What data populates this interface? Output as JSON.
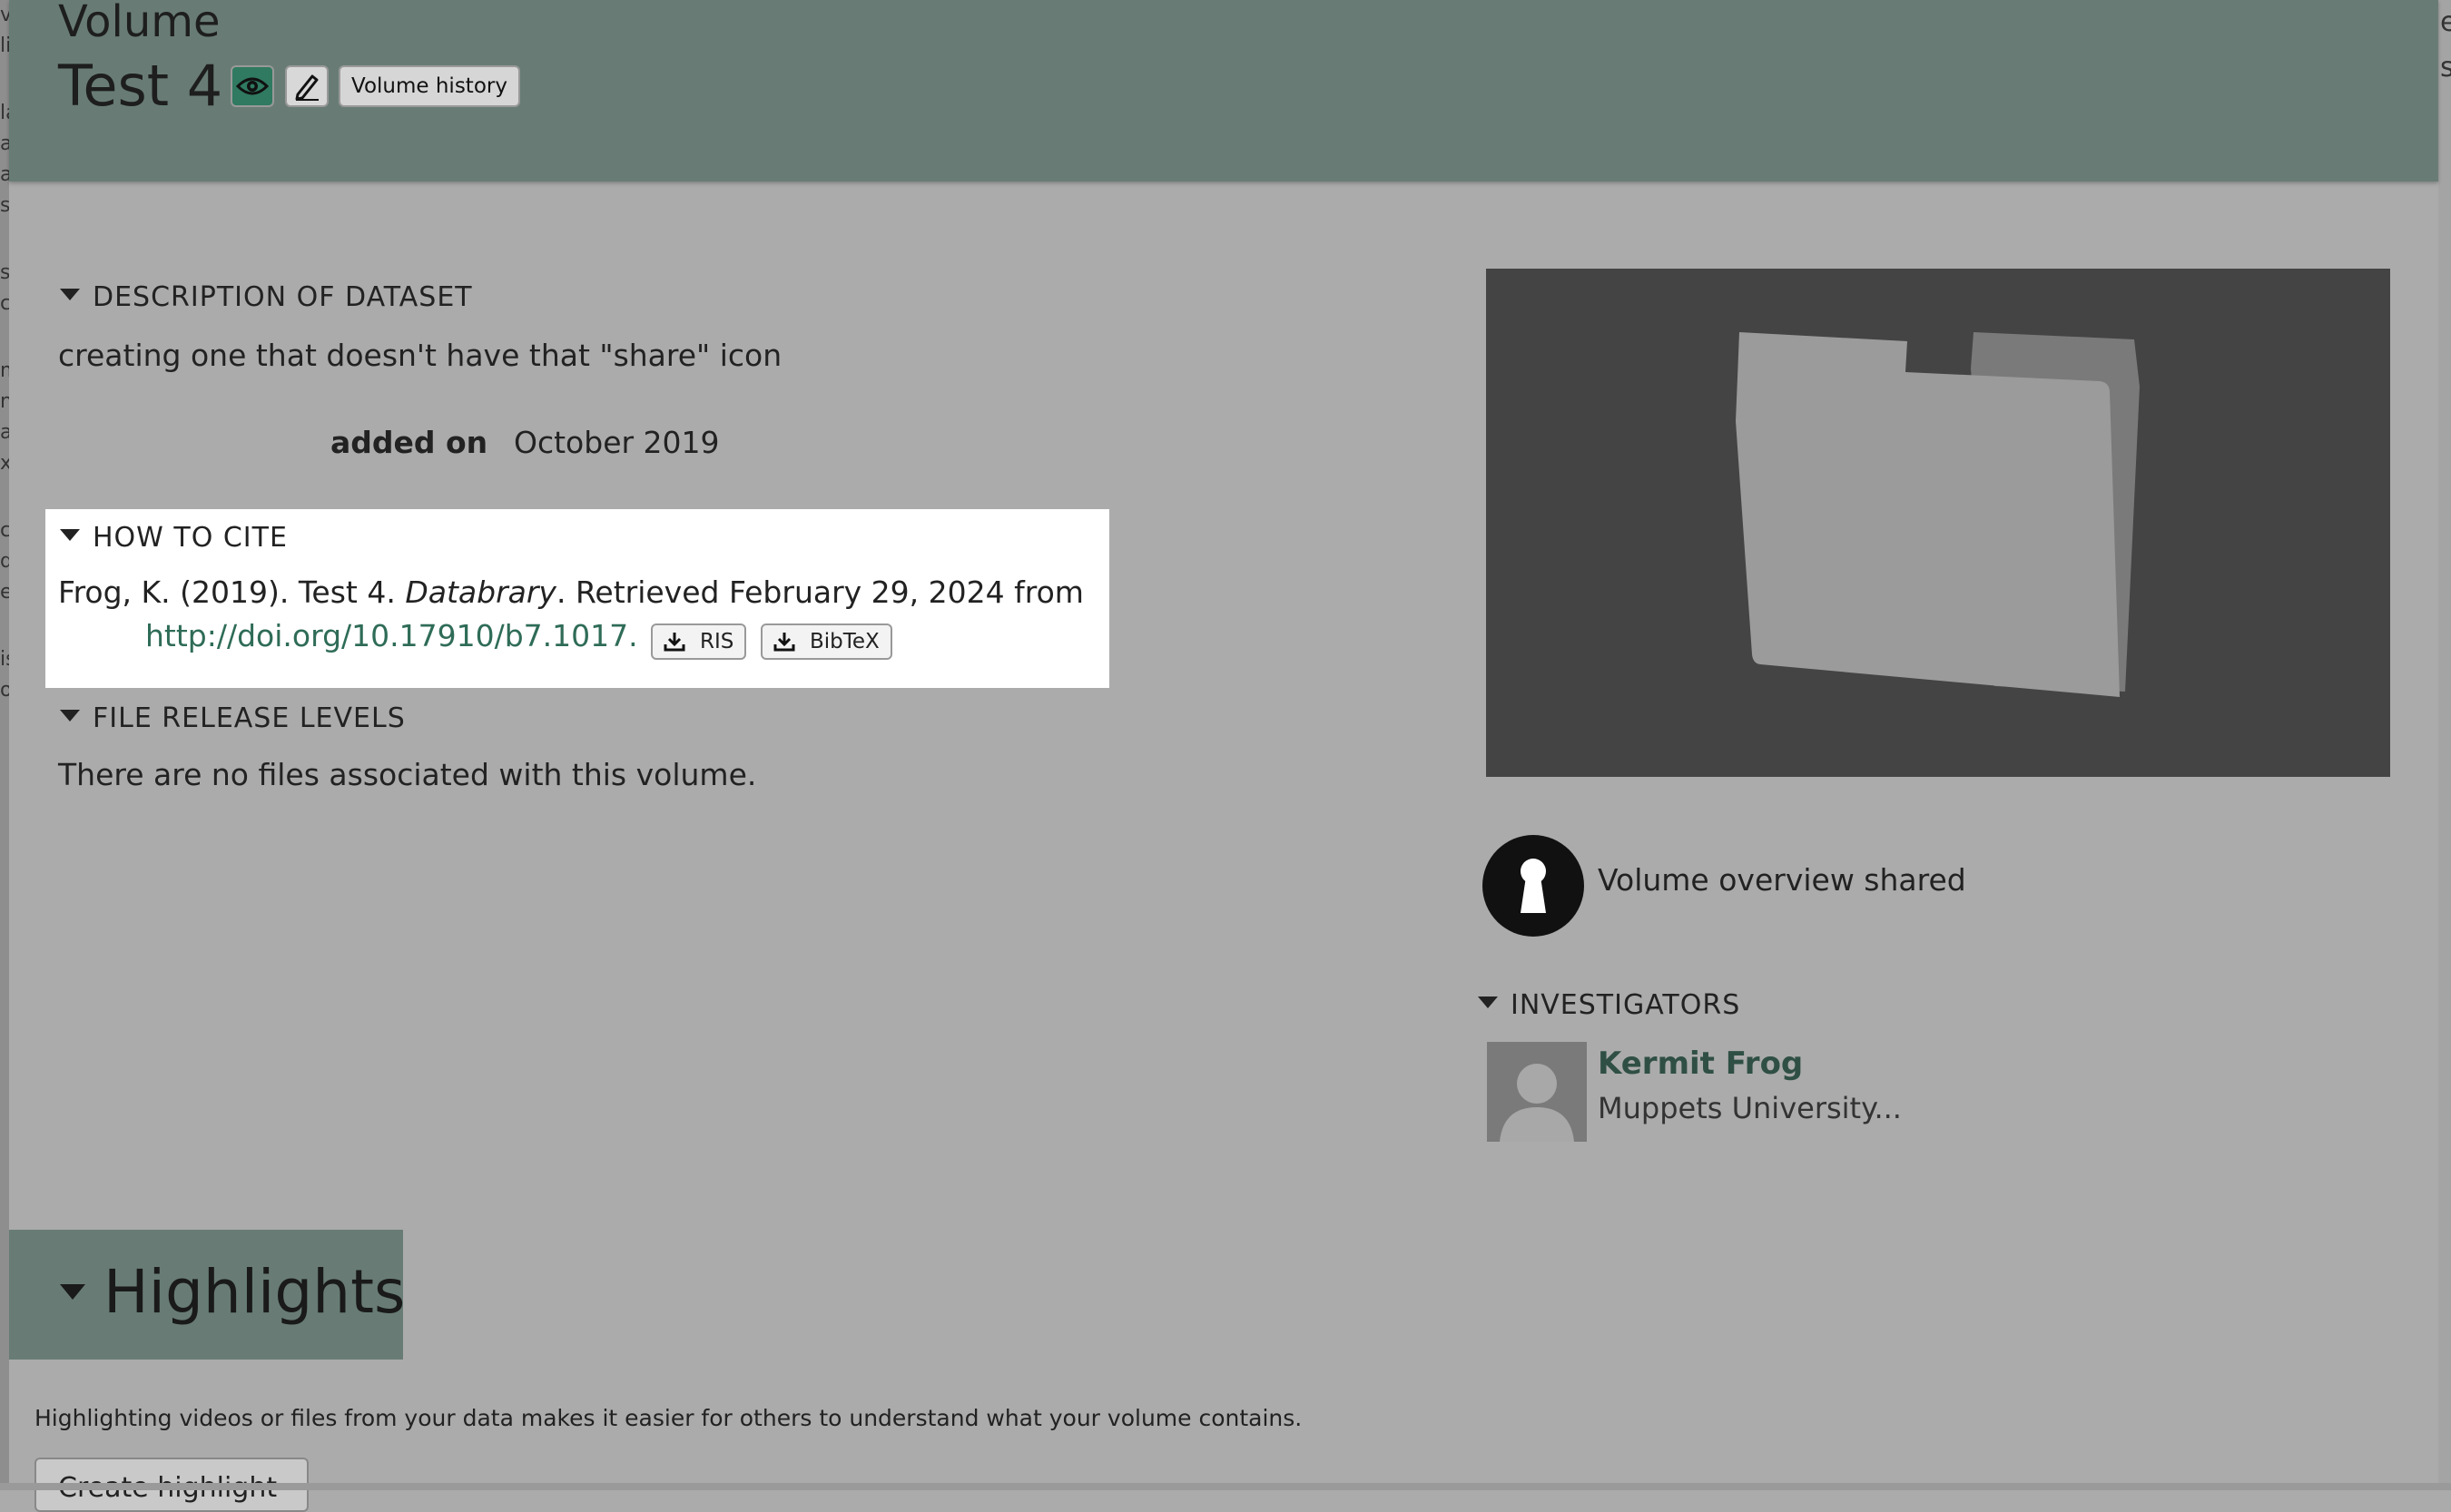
{
  "background_edge_left": [
    "v",
    "li",
    "la",
    "a",
    "a",
    "s",
    "s",
    "c",
    "m",
    "nt",
    "a",
    "xt",
    "c",
    "d",
    "e",
    "is",
    "oe"
  ],
  "background_edge_right": [
    "eg",
    "s"
  ],
  "header": {
    "kind": "Volume",
    "title": "Test 4",
    "history_label": "Volume history",
    "icons": [
      "eye-icon",
      "pencil-icon"
    ],
    "color": "#687c75"
  },
  "description": {
    "heading": "DESCRIPTION OF DATASET",
    "text": "creating one that doesn't have that \"share\" icon",
    "added_label": "added on",
    "added_value": "October 2019"
  },
  "cite": {
    "heading": "HOW TO CITE",
    "authors_year": "Frog, K. (2019). Test 4. ",
    "publisher": "Databrary",
    "retrieved": ". Retrieved February 29, 2024 from",
    "doi": "http://doi.org/10.17910/b7.1017",
    "doi_suffix": ".",
    "ris_label": "RIS",
    "bibtex_label": "BibTeX"
  },
  "release": {
    "heading": "FILE RELEASE LEVELS",
    "text": "There are no files associated with this volume."
  },
  "sharing": {
    "status": "Volume overview shared",
    "icon": "lock-icon"
  },
  "investigators": {
    "heading": "INVESTIGATORS",
    "items": [
      {
        "name": "Kermit Frog",
        "affiliation": "Muppets University..."
      }
    ]
  },
  "highlights": {
    "heading": "Highlights",
    "text": "Highlighting videos or files from your data makes it easier for others to understand what your volume contains.",
    "create_label": "Create highlight"
  }
}
